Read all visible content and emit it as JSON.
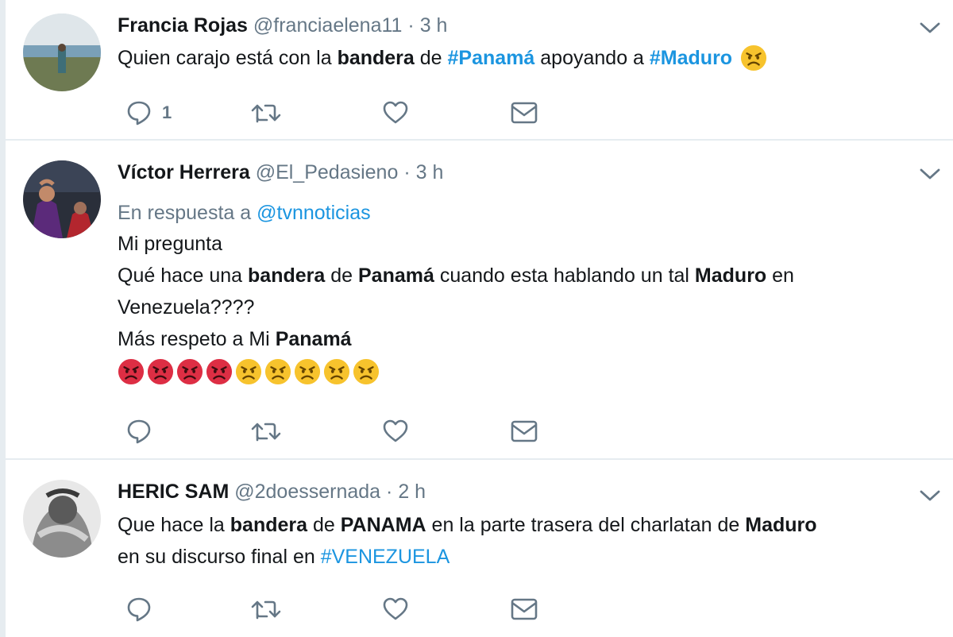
{
  "colors": {
    "link": "#1b95e0",
    "secondary": "#657786",
    "text": "#14171a",
    "divider": "#e6ecf0",
    "emoji_yellow": "#f7c32d",
    "emoji_red": "#dd2e44"
  },
  "icons": {
    "reply": "reply-icon",
    "retweet": "retweet-icon",
    "like": "heart-icon",
    "message": "envelope-icon",
    "menu": "chevron-down-icon"
  },
  "tweets": [
    {
      "name": "Francia Rojas",
      "handle": "@franciaelena11",
      "separator": "·",
      "time": "3 h",
      "text": {
        "t1": "Quien carajo está con la ",
        "b1": "bandera",
        "t2": " de ",
        "tag1": "#Panamá",
        "t3": " apoyando a ",
        "tag2": "#Maduro"
      },
      "reply_count": "1"
    },
    {
      "name": "Víctor Herrera",
      "handle": "@El_Pedasieno",
      "separator": "·",
      "time": "3 h",
      "reply_to_label": "En respuesta a ",
      "reply_to_mention": "@tvnnoticias",
      "text": {
        "line1": "Mi pregunta",
        "l2a": "Qué hace una ",
        "l2b": "bandera",
        "l2c": " de ",
        "l2d": "Panamá",
        "l2e": " cuando esta hablando un tal ",
        "l2f": "Maduro",
        "l2g": " en",
        "line3": "Venezuela????",
        "l4a": "Más respeto a Mi ",
        "l4b": "Panamá"
      },
      "emoji_row": [
        "pouting-face",
        "pouting-face",
        "pouting-face",
        "pouting-face",
        "angry-face",
        "angry-face",
        "angry-face",
        "angry-face",
        "angry-face"
      ],
      "reply_count": ""
    },
    {
      "name": "HERIC SAM",
      "handle": "@2doessernada",
      "separator": "·",
      "time": "2 h",
      "text": {
        "l1a": "Que hace la ",
        "l1b": "bandera",
        "l1c": " de ",
        "l1d": "PANAMA",
        "l1e": " en la parte trasera del charlatan de ",
        "l1f": "Maduro",
        "l2a": "en su discurso final en ",
        "l2b": "#VENEZUELA"
      },
      "reply_count": ""
    }
  ]
}
